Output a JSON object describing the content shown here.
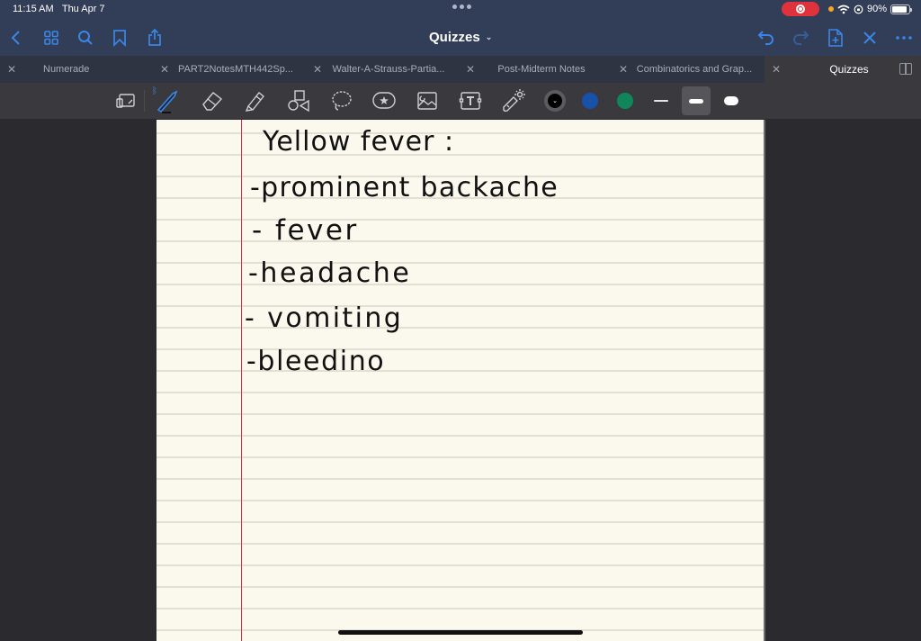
{
  "status_bar": {
    "time": "11:15 AM",
    "date": "Thu Apr 7",
    "battery_percent": "90%",
    "battery_level": 0.9,
    "recording_indicator": "screen-record-icon",
    "icons": [
      "orange-dot-icon",
      "wifi-icon",
      "orientation-lock-icon",
      "battery-icon"
    ]
  },
  "nav": {
    "title": "Quizzes",
    "left_icons": [
      "back-icon",
      "grid-view-icon",
      "search-icon",
      "bookmark-icon",
      "share-icon"
    ],
    "right_icons": [
      "undo-icon",
      "redo-icon",
      "add-page-icon",
      "close-icon",
      "more-icon"
    ]
  },
  "tabs": [
    {
      "label": "Numerade",
      "active": false
    },
    {
      "label": "PART2NotesMTH442Sp...",
      "active": false
    },
    {
      "label": "Walter-A-Strauss-Partia...",
      "active": false
    },
    {
      "label": "Post-Midterm Notes",
      "active": false
    },
    {
      "label": "Combinatorics and Grap...",
      "active": false
    },
    {
      "label": "Quizzes",
      "active": true
    }
  ],
  "toolbar": {
    "tools": [
      "read-only-icon",
      "pen-icon",
      "eraser-icon",
      "highlighter-icon",
      "shapes-icon",
      "lasso-icon",
      "sticker-icon",
      "image-icon",
      "text-icon",
      "laser-pointer-icon"
    ],
    "selected_tool": "pen",
    "bluetooth": "ᛒ",
    "colors": [
      {
        "name": "black",
        "hex": "#000000",
        "selected": true,
        "chevron": "⌄"
      },
      {
        "name": "blue",
        "hex": "#1552a8",
        "selected": false
      },
      {
        "name": "green",
        "hex": "#10875a",
        "selected": false
      }
    ],
    "stroke_widths": [
      "thin",
      "medium",
      "thick"
    ],
    "selected_width": "medium"
  },
  "page": {
    "paper_color": "#fbf8ed",
    "rule_color": "#e2dfd3",
    "margin_color": "#c7344f",
    "handwriting": {
      "title": "Yellow fever :",
      "items": [
        "-prominent backache",
        "- fever",
        "-headache",
        "- vomiting",
        "-bleedino"
      ]
    }
  }
}
